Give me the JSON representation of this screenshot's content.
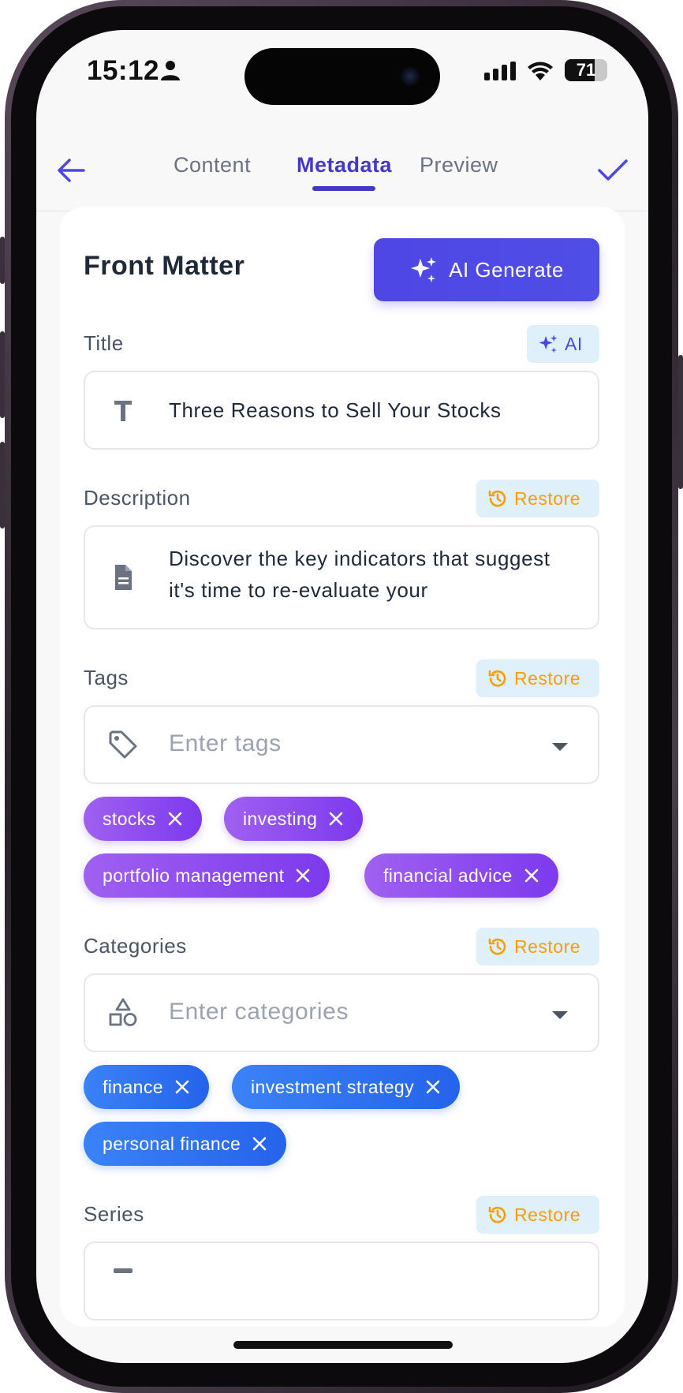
{
  "status_bar": {
    "time": "15:12",
    "battery": "71",
    "battery_level": 0.71
  },
  "nav": {
    "tabs": [
      {
        "label": "Content",
        "active": false
      },
      {
        "label": "Metadata",
        "active": true
      },
      {
        "label": "Preview",
        "active": false
      }
    ]
  },
  "front_matter": {
    "title": "Front Matter",
    "ai_generate_label": "AI Generate"
  },
  "title_field": {
    "label": "Title",
    "ai_label": "AI",
    "value": "Three Reasons to Sell Your Stocks"
  },
  "description_field": {
    "label": "Description",
    "restore_label": "Restore",
    "value": "Discover the key indicators that suggest it's time to re-evaluate your"
  },
  "tags_field": {
    "label": "Tags",
    "restore_label": "Restore",
    "placeholder": "Enter tags",
    "items": [
      "stocks",
      "investing",
      "portfolio management",
      "financial advice"
    ]
  },
  "categories_field": {
    "label": "Categories",
    "restore_label": "Restore",
    "placeholder": "Enter categories",
    "items": [
      "finance",
      "investment strategy",
      "personal finance"
    ]
  },
  "series_field": {
    "label": "Series",
    "restore_label": "Restore"
  },
  "colors": {
    "accent": "#4f46e5",
    "tag_chip": "#7c3aed",
    "category_chip": "#2563eb",
    "restore": "#f59e0b"
  },
  "icons": {
    "back": "arrow-left-icon",
    "done": "checkmark-icon",
    "ai": "sparkles-icon",
    "restore": "history-icon",
    "title": "text-t-icon",
    "description": "document-icon",
    "tags": "tag-icon",
    "categories": "shapes-icon",
    "remove": "close-icon"
  }
}
